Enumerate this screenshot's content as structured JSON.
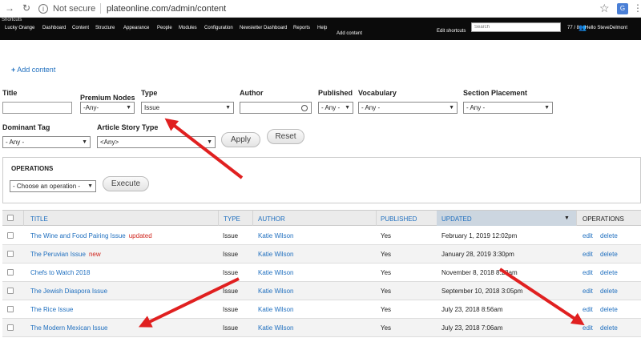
{
  "browser": {
    "not_secure": "Not secure",
    "url": "plateonline.com/admin/content"
  },
  "toolbar": {
    "shortcuts": "Shortcuts",
    "items": [
      "Lucky Orange",
      "Dashboard",
      "Content",
      "Structure",
      "Appearance",
      "People",
      "Modules",
      "Configuration",
      "Newsletter Dashboard",
      "Reports",
      "Help"
    ],
    "add_content": "Add content",
    "edit_shortcuts": "Edit shortcuts",
    "search_placeholder": "Search",
    "count": "77 / 8",
    "hello": "Hello SteveDelmont"
  },
  "add_content_link": "Add content",
  "filters": {
    "title": {
      "label": "Title",
      "value": ""
    },
    "premium_nodes": {
      "label": "Premium Nodes",
      "value": "-Any-"
    },
    "type": {
      "label": "Type",
      "value": "Issue"
    },
    "author": {
      "label": "Author",
      "value": ""
    },
    "published": {
      "label": "Published",
      "value": "- Any -"
    },
    "vocabulary": {
      "label": "Vocabulary",
      "value": "- Any -"
    },
    "section_placement": {
      "label": "Section Placement",
      "value": "- Any -"
    },
    "dominant_tag": {
      "label": "Dominant Tag",
      "value": "- Any -"
    },
    "article_story_type": {
      "label": "Article Story Type",
      "value": "<Any>"
    },
    "apply": "Apply",
    "reset": "Reset"
  },
  "operations": {
    "title": "OPERATIONS",
    "select_value": "- Choose an operation -",
    "execute": "Execute"
  },
  "table": {
    "headers": {
      "title": "TITLE",
      "type": "TYPE",
      "author": "AUTHOR",
      "published": "PUBLISHED",
      "updated": "UPDATED",
      "operations": "OPERATIONS"
    },
    "rows": [
      {
        "title": "The Wine and Food Pairing Issue",
        "tag": "updated",
        "type": "Issue",
        "author": "Katie Wilson",
        "published": "Yes",
        "updated": "February 1, 2019 12:02pm",
        "edit": "edit",
        "delete": "delete"
      },
      {
        "title": "The Peruvian Issue",
        "tag": "new",
        "type": "Issue",
        "author": "Katie Wilson",
        "published": "Yes",
        "updated": "January 28, 2019 3:30pm",
        "edit": "edit",
        "delete": "delete"
      },
      {
        "title": "Chefs to Watch 2018",
        "tag": "",
        "type": "Issue",
        "author": "Katie Wilson",
        "published": "Yes",
        "updated": "November 8, 2018 8:28am",
        "edit": "edit",
        "delete": "delete"
      },
      {
        "title": "The Jewish Diaspora Issue",
        "tag": "",
        "type": "Issue",
        "author": "Katie Wilson",
        "published": "Yes",
        "updated": "September 10, 2018 3:05pm",
        "edit": "edit",
        "delete": "delete"
      },
      {
        "title": "The Rice Issue",
        "tag": "",
        "type": "Issue",
        "author": "Katie Wilson",
        "published": "Yes",
        "updated": "July 23, 2018 8:56am",
        "edit": "edit",
        "delete": "delete"
      },
      {
        "title": "The Modern Mexican Issue",
        "tag": "",
        "type": "Issue",
        "author": "Katie Wilson",
        "published": "Yes",
        "updated": "July 23, 2018 7:06am",
        "edit": "edit",
        "delete": "delete"
      }
    ]
  },
  "colors": {
    "link": "#1f6fbf",
    "tag": "#d0261e",
    "arrow": "#e02020",
    "toolbar": "#0b0b0b"
  }
}
